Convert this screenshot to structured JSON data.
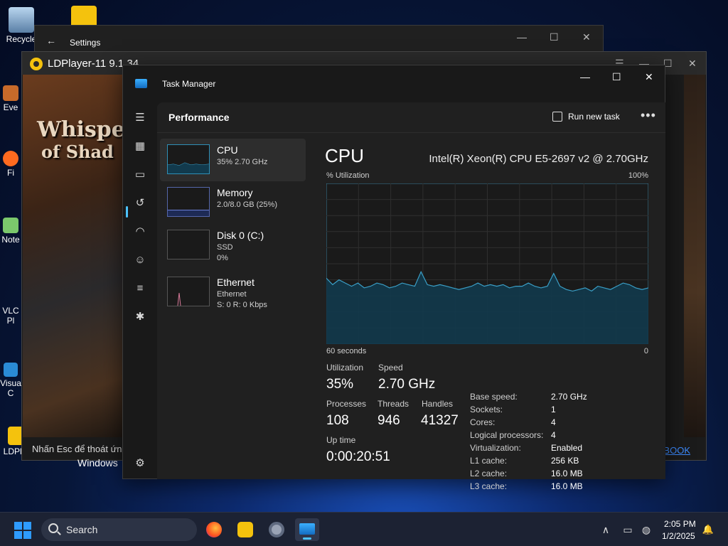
{
  "desktop": {
    "icons": [
      {
        "label": "Recycle"
      },
      {
        "label": "Eve"
      },
      {
        "label": "Fi"
      },
      {
        "label": "Note"
      },
      {
        "label": "VLC"
      },
      {
        "label": "Pl"
      },
      {
        "label": "Visua"
      },
      {
        "label": "C"
      },
      {
        "label": "LDPlay"
      }
    ]
  },
  "settings_window": {
    "title": "Settings",
    "back_icon": "←",
    "minimize": "—",
    "maximize": "☐",
    "close": "✕"
  },
  "ldplayer_window": {
    "title": "LDPlayer-11 9.1.34",
    "game_title_top": "Whisper",
    "game_title_bottom": "of Shad",
    "esc_hint": "Nhấn Esc để thoát ứng",
    "windows_update": "Windows",
    "ebook_link": "BOOK",
    "menu": "☰",
    "minimize": "—",
    "maximize": "☐",
    "close": "✕"
  },
  "task_manager": {
    "title": "Task Manager",
    "minimize": "—",
    "maximize": "☐",
    "close": "✕",
    "page_title": "Performance",
    "run_new_task": "Run new task",
    "more": "•••",
    "list": [
      {
        "name": "CPU",
        "line2": "35%  2.70 GHz",
        "line3": ""
      },
      {
        "name": "Memory",
        "line2": "2.0/8.0 GB (25%)",
        "line3": ""
      },
      {
        "name": "Disk 0 (C:)",
        "line2": "SSD",
        "line3": "0%"
      },
      {
        "name": "Ethernet",
        "line2": "Ethernet",
        "line3": "S: 0  R: 0 Kbps"
      }
    ],
    "detail": {
      "heading": "CPU",
      "model": "Intel(R) Xeon(R) CPU E5-2697 v2 @ 2.70GHz",
      "y_label": "% Utilization",
      "y_max_label": "100%",
      "x_label": "60 seconds",
      "x_min_label": "0",
      "stats": {
        "utilization_label": "Utilization",
        "utilization": "35%",
        "speed_label": "Speed",
        "speed": "2.70 GHz",
        "processes_label": "Processes",
        "processes": "108",
        "threads_label": "Threads",
        "threads": "946",
        "handles_label": "Handles",
        "handles": "41327",
        "uptime_label": "Up time",
        "uptime": "0:00:20:51"
      },
      "specs": [
        {
          "k": "Base speed:",
          "v": "2.70 GHz"
        },
        {
          "k": "Sockets:",
          "v": "1"
        },
        {
          "k": "Cores:",
          "v": "4"
        },
        {
          "k": "Logical processors:",
          "v": "4"
        },
        {
          "k": "Virtualization:",
          "v": "Enabled"
        },
        {
          "k": "L1 cache:",
          "v": "256 KB"
        },
        {
          "k": "L2 cache:",
          "v": "16.0 MB"
        },
        {
          "k": "L3 cache:",
          "v": "16.0 MB"
        }
      ]
    },
    "colors": {
      "graph_line": "#3a9fc7",
      "graph_fill": "#123a4d",
      "accent": "#4cc2ff"
    }
  },
  "chart_data": {
    "type": "area",
    "ylim": [
      0,
      100
    ],
    "values": [
      41,
      37,
      40,
      38,
      36,
      38,
      35,
      36,
      38,
      37,
      35,
      36,
      38,
      37,
      36,
      45,
      37,
      36,
      37,
      36,
      35,
      34,
      35,
      36,
      38,
      36,
      37,
      36,
      37,
      35,
      36,
      36,
      38,
      36,
      35,
      36,
      44,
      36,
      34,
      33,
      34,
      35,
      33,
      36,
      35,
      34,
      36,
      38,
      37,
      35,
      34,
      35
    ]
  },
  "taskbar": {
    "search_placeholder": "Search",
    "time": "2:05 PM",
    "date": "1/2/2025",
    "chevron": "∧",
    "bell": "🔔"
  }
}
